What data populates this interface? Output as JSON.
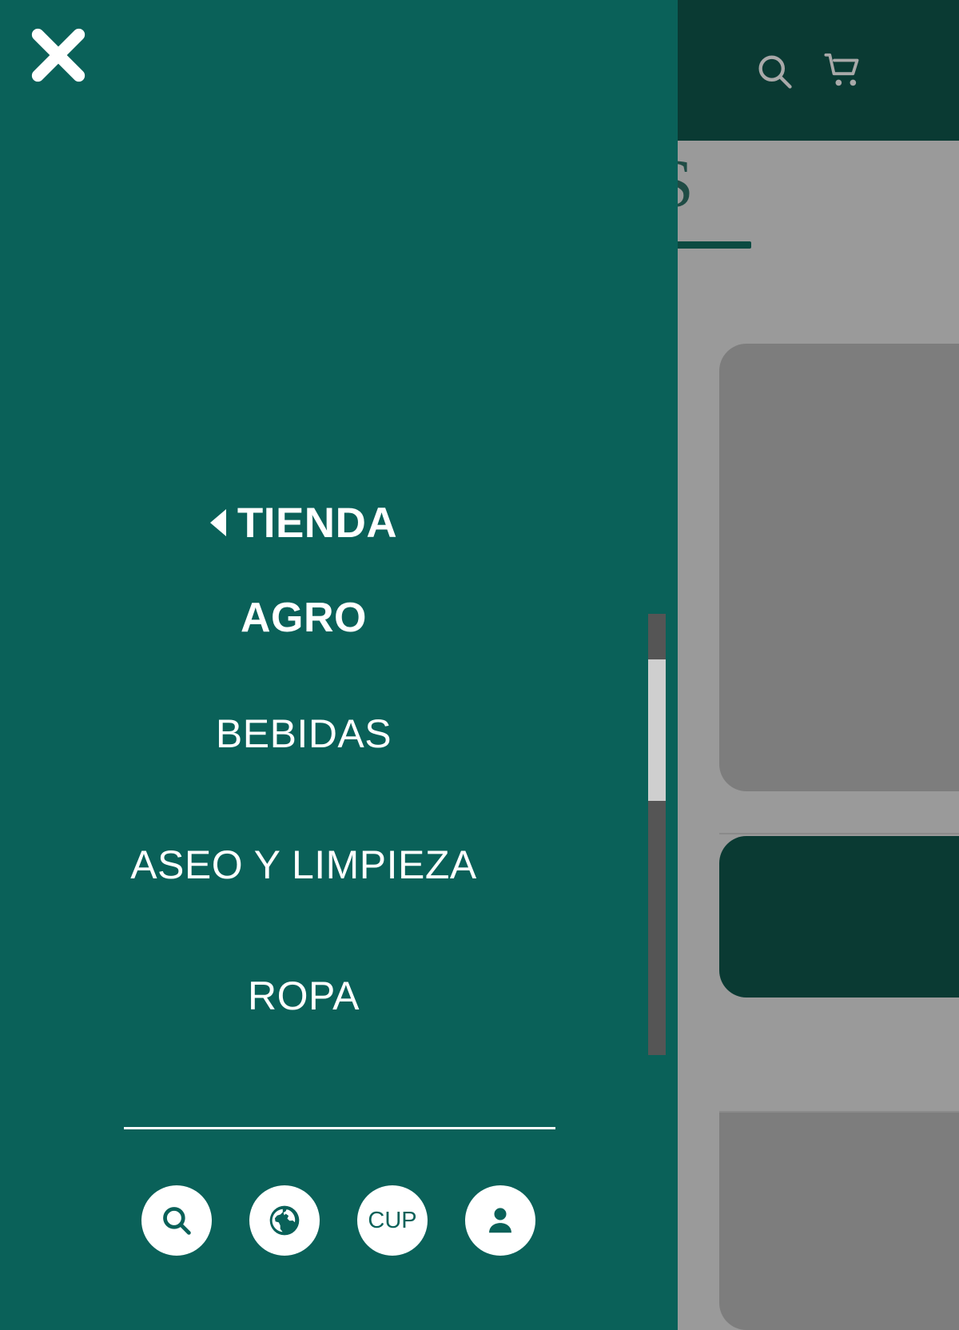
{
  "theme": {
    "drawer_bg": "#0a6159",
    "header_bg": "#0a3a33",
    "accent": "#0b4a41",
    "text_on_dark": "#ffffff",
    "scrollbar_track": "#555555",
    "scrollbar_thumb": "#cfcfcf",
    "dim_overlay": "#9a9a9a"
  },
  "background_page": {
    "header": {
      "search_icon": "search-icon",
      "cart_icon": "shopping-cart-icon"
    },
    "title_fragment": "S",
    "card_menu_icon": "more-vertical-icon"
  },
  "drawer": {
    "close_icon": "close-icon",
    "close_label": "Cerrar",
    "parent_item": {
      "caret_icon": "caret-left-icon",
      "label": "TIENDA"
    },
    "current_item": {
      "label": "AGRO"
    },
    "items": [
      {
        "label": "BEBIDAS"
      },
      {
        "label": "ASEO Y LIMPIEZA"
      },
      {
        "label": "ROPA"
      }
    ],
    "scrollbar": {
      "thumb_top_pct": 10,
      "thumb_height_pct": 32
    },
    "actions": [
      {
        "icon": "search-icon",
        "label": "Buscar"
      },
      {
        "icon": "globe-icon",
        "label": "Idioma"
      },
      {
        "icon": "currency-text",
        "label": "CUP"
      },
      {
        "icon": "user-icon",
        "label": "Cuenta"
      }
    ]
  }
}
